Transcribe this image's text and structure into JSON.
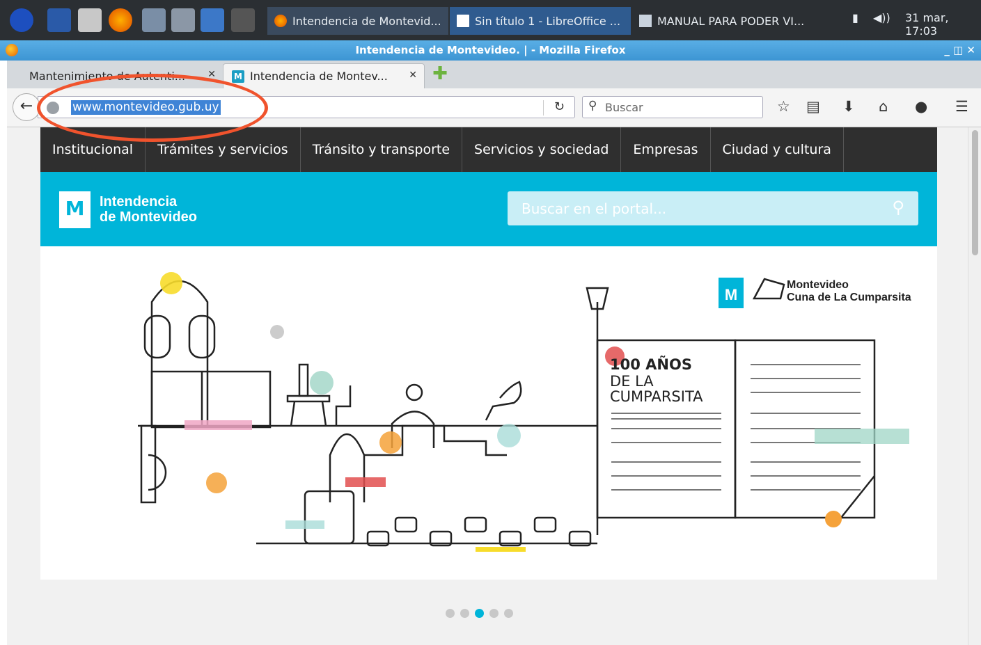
{
  "taskbar": {
    "tasks": [
      {
        "label": "Intendencia de Montevid..."
      },
      {
        "label": "Sin título 1 - LibreOffice ..."
      },
      {
        "label": "MANUAL PARA PODER VI..."
      }
    ],
    "clock": "31 mar, 17:03"
  },
  "window": {
    "title": "Intendencia de Montevideo. | - Mozilla Firefox",
    "controls": "_ ◫ ✕"
  },
  "tabs": [
    {
      "label": "Mantenimiento de Autenti..."
    },
    {
      "label": "Intendencia de Montev..."
    }
  ],
  "toolbar": {
    "url": "www.montevideo.gub.uy",
    "search_placeholder": "Buscar"
  },
  "site": {
    "nav": [
      "Institucional",
      "Trámites y servicios",
      "Tránsito y transporte",
      "Servicios y sociedad",
      "Empresas",
      "Ciudad y cultura"
    ],
    "logo_line1": "Intendencia",
    "logo_line2": "de Montevideo",
    "search_placeholder": "Buscar en el portal...",
    "banner": {
      "brand_line1": "Montevideo",
      "brand_line2": "Cuna de La Cumparsita",
      "book_line1": "100 AÑOS",
      "book_line2": "DE LA",
      "book_line3": "CUMPARSITA"
    },
    "carousel": {
      "count": 5,
      "active": 3
    }
  },
  "colors": {
    "accent": "#00b5d9",
    "nav_bg": "#2f2f2f",
    "annotation": "#f0532d",
    "firefox_title": "#3d95d3"
  }
}
